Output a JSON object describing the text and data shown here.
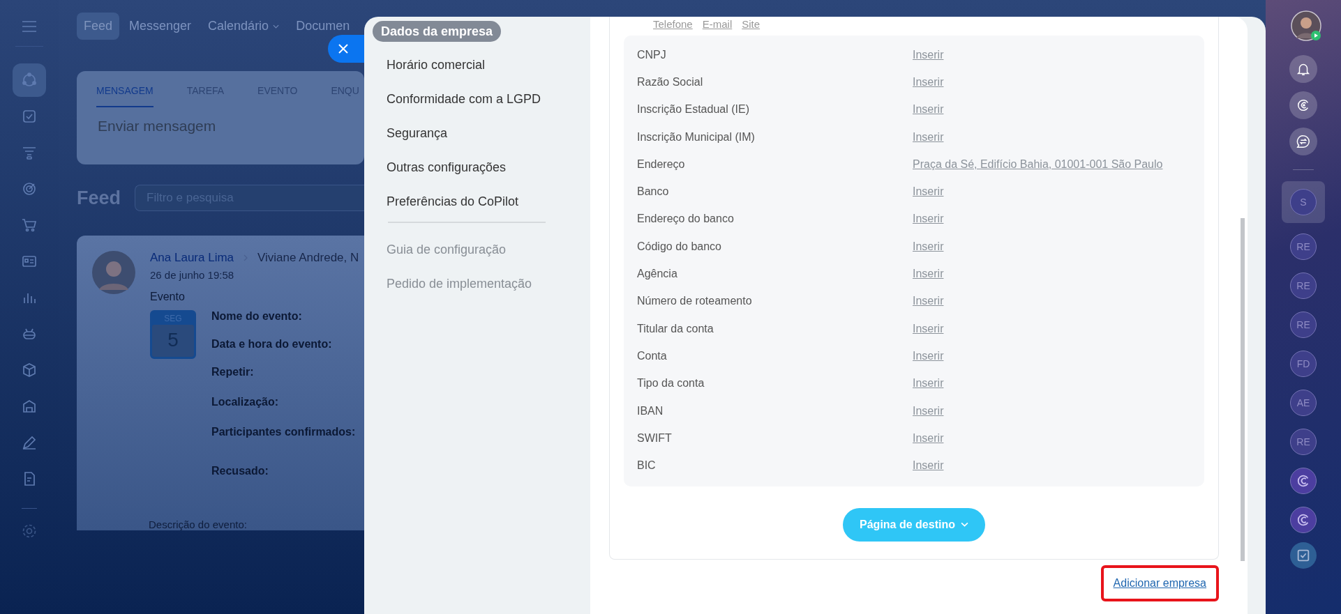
{
  "top_nav": [
    {
      "label": "Feed",
      "selected": true,
      "has_caret": false
    },
    {
      "label": "Messenger",
      "selected": false,
      "has_caret": false
    },
    {
      "label": "Calendário",
      "selected": false,
      "has_caret": true
    },
    {
      "label": "Documen",
      "selected": false,
      "has_caret": false
    }
  ],
  "sidebar_items": [
    {
      "kind": "activity",
      "selected": true
    },
    {
      "kind": "tasks",
      "selected": false
    },
    {
      "kind": "funnel",
      "selected": false
    },
    {
      "kind": "target",
      "selected": false
    },
    {
      "kind": "cart",
      "selected": false
    },
    {
      "kind": "card",
      "selected": false
    },
    {
      "kind": "chart",
      "selected": false
    },
    {
      "kind": "robot",
      "selected": false
    },
    {
      "kind": "box",
      "selected": false
    },
    {
      "kind": "store",
      "selected": false
    },
    {
      "kind": "pen",
      "selected": false
    },
    {
      "kind": "doc",
      "selected": false
    }
  ],
  "composer": {
    "tabs": [
      {
        "label": "MENSAGEM",
        "selected": true
      },
      {
        "label": "TAREFA",
        "selected": false
      },
      {
        "label": "EVENTO",
        "selected": false
      },
      {
        "label": "ENQU",
        "selected": false
      }
    ],
    "placeholder": "Enviar mensagem"
  },
  "feed": {
    "title": "Feed",
    "search_placeholder": "Filtro e pesquisa"
  },
  "post": {
    "author": "Ana Laura Lima",
    "recipient": "Viviane Andrede, N",
    "time": "26 de junho 19:58",
    "type": "Evento",
    "calendar": {
      "weekday": "SEG",
      "day": "5"
    },
    "fields": [
      "Nome do evento:",
      "Data e hora do evento:",
      "Repetir:",
      "Localização:",
      "Participantes confirmados:",
      "Recusado:"
    ],
    "description_label": "Descrição do evento:"
  },
  "settings_menu": {
    "items": [
      {
        "label": "Dados da empresa",
        "selected": true
      },
      {
        "label": "Horário comercial",
        "selected": false
      },
      {
        "label": "Conformidade com a LGPD",
        "selected": false
      },
      {
        "label": "Segurança",
        "selected": false
      },
      {
        "label": "Outras configurações",
        "selected": false
      },
      {
        "label": "Preferências do CoPilot",
        "selected": false
      }
    ],
    "secondary": [
      "Guia de configuração",
      "Pedido de implementação"
    ]
  },
  "contact_links": [
    "Telefone",
    "E-mail",
    "Site"
  ],
  "details": [
    {
      "label": "CNPJ",
      "value": "Inserir"
    },
    {
      "label": "Razão Social",
      "value": "Inserir"
    },
    {
      "label": "Inscrição Estadual (IE)",
      "value": "Inserir"
    },
    {
      "label": "Inscrição Municipal (IM)",
      "value": "Inserir"
    },
    {
      "label": "Endereço",
      "value": "Praça da Sé, Edifício Bahia, 01001-001 São Paulo"
    },
    {
      "label": "Banco",
      "value": "Inserir"
    },
    {
      "label": "Endereço do banco",
      "value": "Inserir"
    },
    {
      "label": "Código do banco",
      "value": "Inserir"
    },
    {
      "label": "Agência",
      "value": "Inserir"
    },
    {
      "label": "Número de roteamento",
      "value": "Inserir"
    },
    {
      "label": "Titular da conta",
      "value": "Inserir"
    },
    {
      "label": "Conta",
      "value": "Inserir"
    },
    {
      "label": "Tipo da conta",
      "value": "Inserir"
    },
    {
      "label": "IBAN",
      "value": "Inserir"
    },
    {
      "label": "SWIFT",
      "value": "Inserir"
    },
    {
      "label": "BIC",
      "value": "Inserir"
    }
  ],
  "landing_button": "Página de destino",
  "add_company": {
    "label": "Adicionar empresa",
    "highlighted": true
  },
  "right_rail": {
    "chats": [
      {
        "kind": "initials",
        "initials": "S",
        "selected": true
      },
      {
        "kind": "initials",
        "initials": "RE",
        "selected": false
      },
      {
        "kind": "initials",
        "initials": "RE",
        "selected": false
      },
      {
        "kind": "initials",
        "initials": "RE",
        "selected": false
      },
      {
        "kind": "initials",
        "initials": "FD",
        "selected": false
      },
      {
        "kind": "initials",
        "initials": "AE",
        "selected": false
      },
      {
        "kind": "initials",
        "initials": "RE",
        "selected": false
      },
      {
        "kind": "copilot",
        "selected": false
      },
      {
        "kind": "copilot",
        "selected": false
      }
    ]
  }
}
